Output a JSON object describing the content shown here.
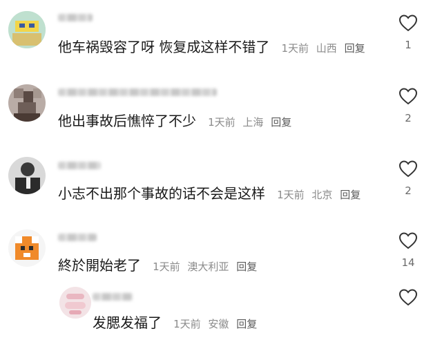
{
  "comments": [
    {
      "text": "他车祸毁容了呀 恢复成这样不错了",
      "time": "1天前",
      "location": "山西",
      "reply": "回复",
      "likes": "1"
    },
    {
      "text": "他出事故后憔悴了不少",
      "time": "1天前",
      "location": "上海",
      "reply": "回复",
      "likes": "2"
    },
    {
      "text": "小志不出那个事故的话不会是这样",
      "time": "1天前",
      "location": "北京",
      "reply": "回复",
      "likes": "2"
    },
    {
      "text": "終於開始老了",
      "time": "1天前",
      "location": "澳大利亚",
      "reply": "回复",
      "likes": "14"
    },
    {
      "text": "发腮发福了",
      "time": "1天前",
      "location": "安徽",
      "reply": "回复",
      "likes": ""
    }
  ],
  "icons": {
    "like": "heart-outline-icon"
  },
  "colors": {
    "text": "#1a1a1a",
    "meta": "#8a8a8a",
    "icon": "#333333"
  }
}
